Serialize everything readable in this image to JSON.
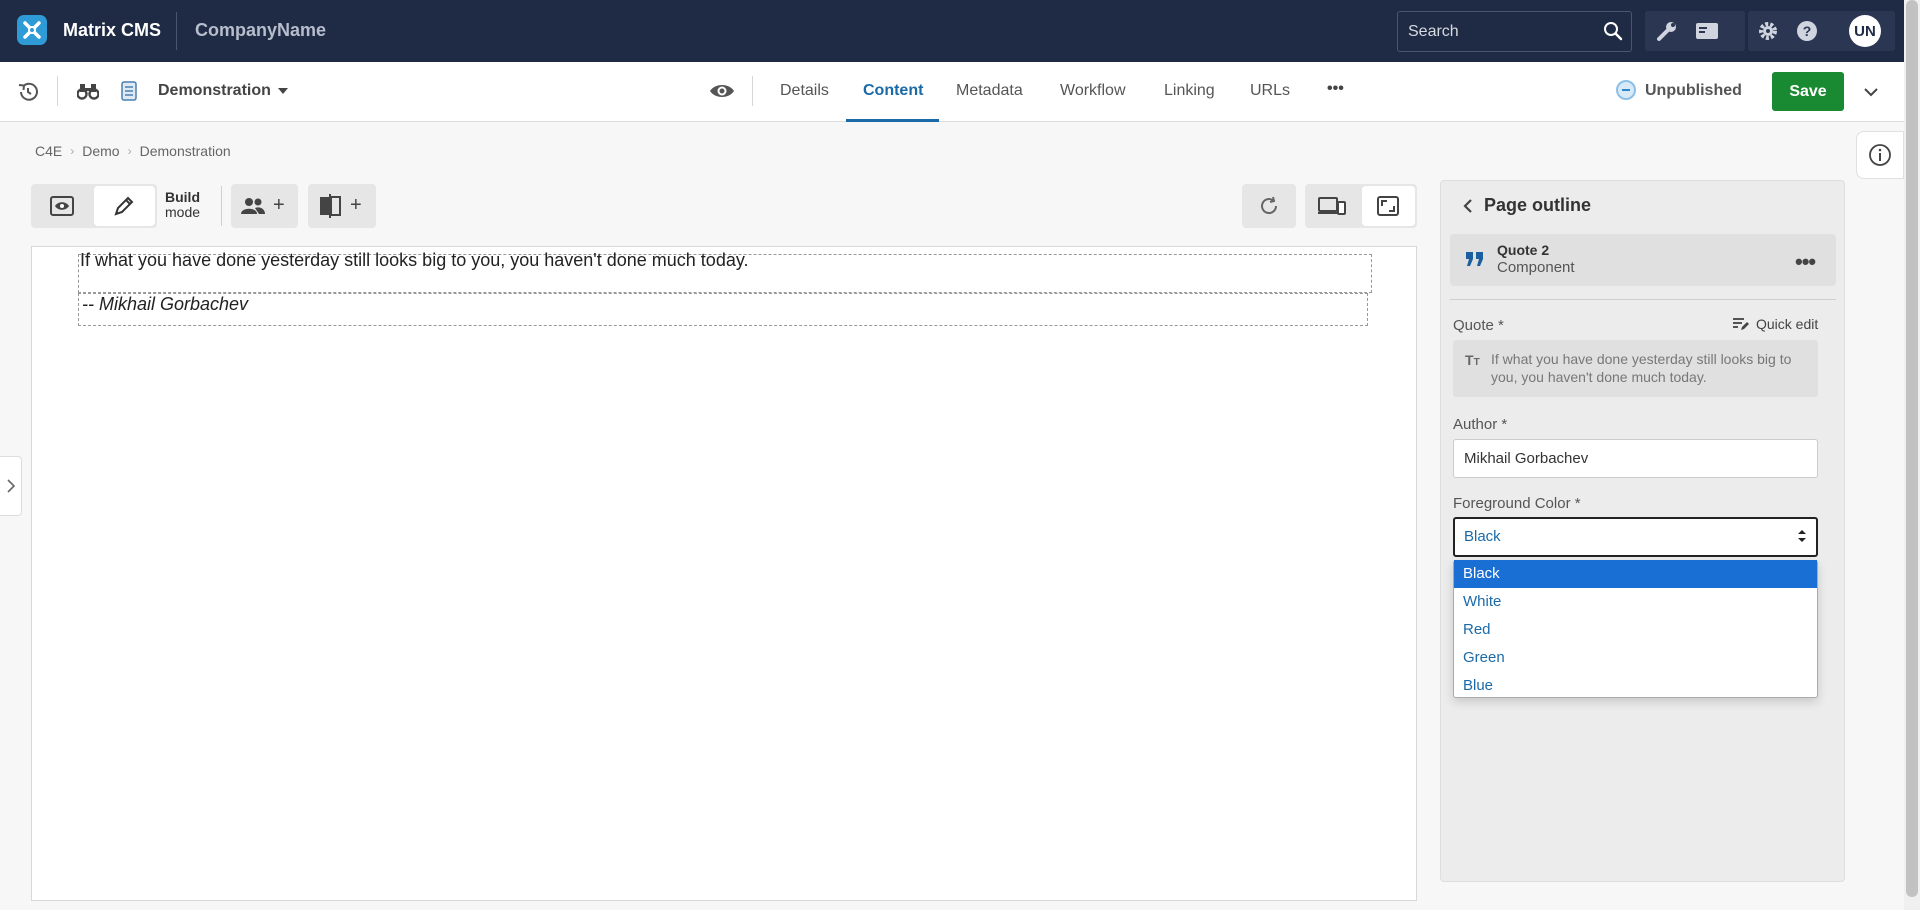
{
  "topbar": {
    "app_name": "Matrix CMS",
    "company": "CompanyName",
    "search_placeholder": "Search",
    "user_initials": "UN",
    "icons": [
      "logo-icon",
      "search-icon",
      "wrench-icon",
      "card-icon",
      "gear-icon",
      "help-icon"
    ]
  },
  "subbar": {
    "asset_name": "Demonstration",
    "tabs": [
      "Details",
      "Content",
      "Metadata",
      "Workflow",
      "Linking",
      "URLs"
    ],
    "active_tab": "Content",
    "more": "•••",
    "status": "Unpublished",
    "save_label": "Save"
  },
  "breadcrumb": [
    "C4E",
    "Demo",
    "Demonstration"
  ],
  "toolbar": {
    "build_line1": "Build",
    "build_line2": "mode",
    "plus": "+"
  },
  "canvas": {
    "quote": "If what you have done yesterday still looks big to you, you haven't done much today.",
    "author": "-- Mikhail Gorbachev"
  },
  "panel": {
    "title": "Page outline",
    "component_name": "Quote 2",
    "component_type": "Component",
    "quote_label": "Quote *",
    "quick_edit": "Quick edit",
    "quote_value": "If what you have done yesterday still looks big to you, you haven't done much today.",
    "author_label": "Author *",
    "author_value": "Mikhail Gorbachev",
    "color_label": "Foreground Color *",
    "color_value": "Black",
    "color_options": [
      "Black",
      "White",
      "Red",
      "Green",
      "Blue"
    ],
    "selected_option": "Black"
  },
  "colors": {
    "topbar_bg": "#1f2a44",
    "accent": "#1b6aa8",
    "save_green": "#1a8a32",
    "option_highlight": "#1a6fd4"
  }
}
